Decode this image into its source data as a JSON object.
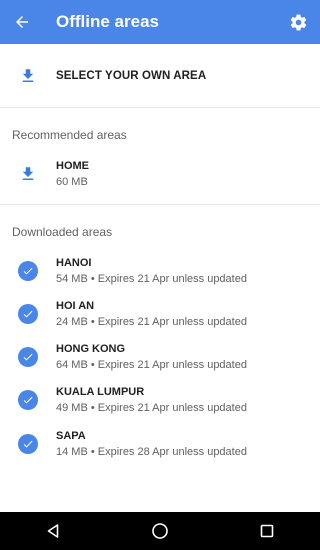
{
  "appbar": {
    "title": "Offline areas",
    "back_icon": "arrow-back-icon",
    "settings_icon": "gear-icon",
    "color": "#4a86e8"
  },
  "select_area": {
    "label": "SELECT YOUR OWN AREA",
    "icon": "download-icon"
  },
  "recommended": {
    "header": "Recommended areas",
    "items": [
      {
        "name": "HOME",
        "meta": "60 MB",
        "icon": "download-icon"
      }
    ]
  },
  "downloaded": {
    "header": "Downloaded areas",
    "items": [
      {
        "name": "HANOI",
        "meta": "54 MB • Expires 21 Apr unless updated",
        "icon": "check-circle-icon"
      },
      {
        "name": "HOI AN",
        "meta": "24 MB • Expires 21 Apr unless updated",
        "icon": "check-circle-icon"
      },
      {
        "name": "HONG KONG",
        "meta": "64 MB • Expires 21 Apr unless updated",
        "icon": "check-circle-icon"
      },
      {
        "name": "KUALA LUMPUR",
        "meta": "49 MB • Expires 21 Apr unless updated",
        "icon": "check-circle-icon"
      },
      {
        "name": "SAPA",
        "meta": "14 MB • Expires 28 Apr unless updated",
        "icon": "check-circle-icon"
      }
    ]
  },
  "navbar": {
    "back": "nav-back-icon",
    "home": "nav-home-icon",
    "recents": "nav-recents-icon"
  }
}
